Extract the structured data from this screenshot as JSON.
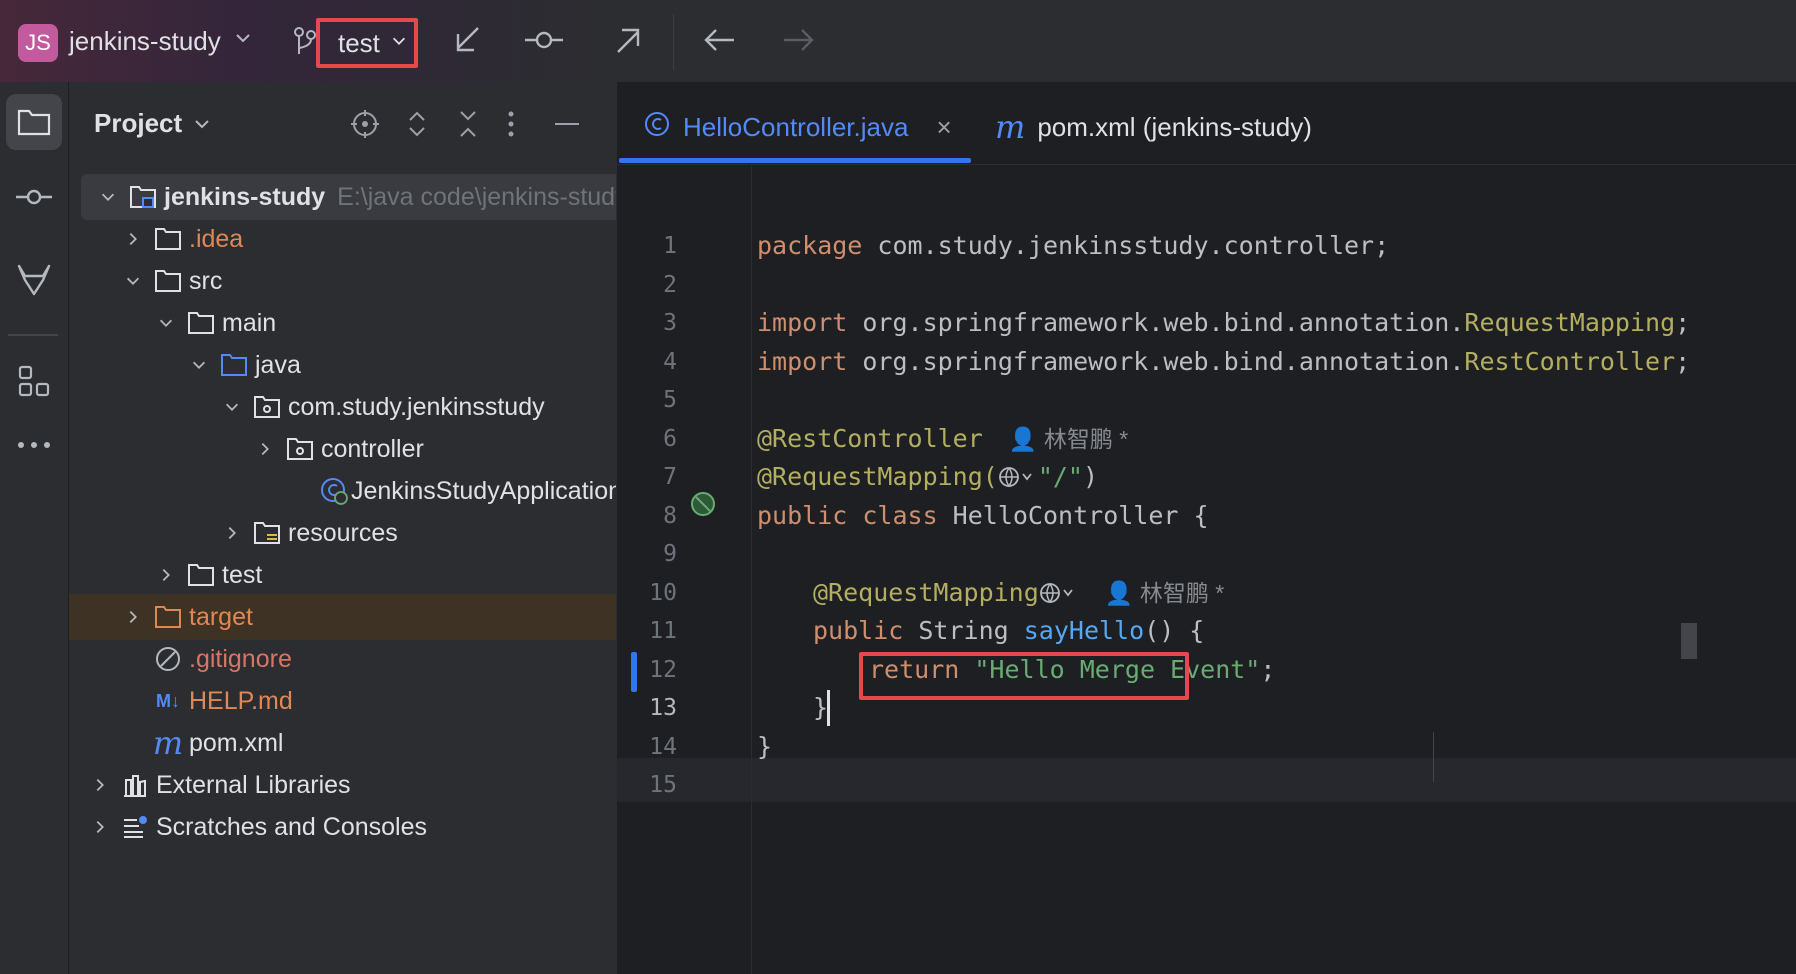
{
  "topbar": {
    "project_badge": "JS",
    "project_name": "jenkins-study",
    "branch": "test",
    "actions": [
      "update-project-icon",
      "commit-icon",
      "push-icon",
      "back-icon",
      "forward-icon"
    ]
  },
  "toolstrip": {
    "items": [
      "folder-icon",
      "commit-icon",
      "gitlab-icon",
      "structure-icon",
      "more-icon"
    ]
  },
  "project_panel": {
    "title": "Project",
    "tree": [
      {
        "label": "jenkins-study",
        "path": "E:\\java code\\jenkins-study"
      },
      {
        "label": ".idea"
      },
      {
        "label": "src"
      },
      {
        "label": "main"
      },
      {
        "label": "java"
      },
      {
        "label": "com.study.jenkinsstudy"
      },
      {
        "label": "controller"
      },
      {
        "label": "JenkinsStudyApplication"
      },
      {
        "label": "resources"
      },
      {
        "label": "test"
      },
      {
        "label": "target"
      },
      {
        "label": ".gitignore"
      },
      {
        "label": "HELP.md",
        "badge": "M↓"
      },
      {
        "label": "pom.xml",
        "badge": "m"
      },
      {
        "label": "External Libraries"
      },
      {
        "label": "Scratches and Consoles"
      }
    ]
  },
  "editor": {
    "tabs": [
      {
        "label": "HelloController.java",
        "active": true
      },
      {
        "label": "pom.xml (jenkins-study)",
        "active": false
      }
    ],
    "tab_close": "×",
    "line_numbers": [
      "1",
      "2",
      "3",
      "4",
      "5",
      "6",
      "7",
      "8",
      "9",
      "10",
      "11",
      "12",
      "13",
      "14",
      "15"
    ],
    "current_line": "13",
    "code": {
      "l1_kw": "package",
      "l1_rest": " com.study.jenkinsstudy.controller;",
      "l3_kw": "import",
      "l3_pkg": " org.springframework.web.bind.annotation.",
      "l3_cls": "RequestMapping",
      "l3_end": ";",
      "l4_kw": "import",
      "l4_pkg": " org.springframework.web.bind.annotation.",
      "l4_cls": "RestController",
      "l4_end": ";",
      "l6_ann": "@RestController",
      "l6_hint": "林智鹏 *",
      "l7_ann": "@RequestMapping(",
      "l7_str": "\"/\"",
      "l7_end": ")",
      "l8_kw": "public class",
      "l8_rest": " HelloController {",
      "l10_ann": "@RequestMapping",
      "l10_hint": "林智鹏 *",
      "l11_kw": "public",
      "l11_ty": " String ",
      "l11_fn": "sayHello",
      "l11_end": "() {",
      "l12_kw": "return",
      "l12_str": "\"Hello Merge Event\"",
      "l12_end": ";",
      "l13_text": "}",
      "l14_text": "}"
    },
    "highlight_color": "#e5484d"
  }
}
